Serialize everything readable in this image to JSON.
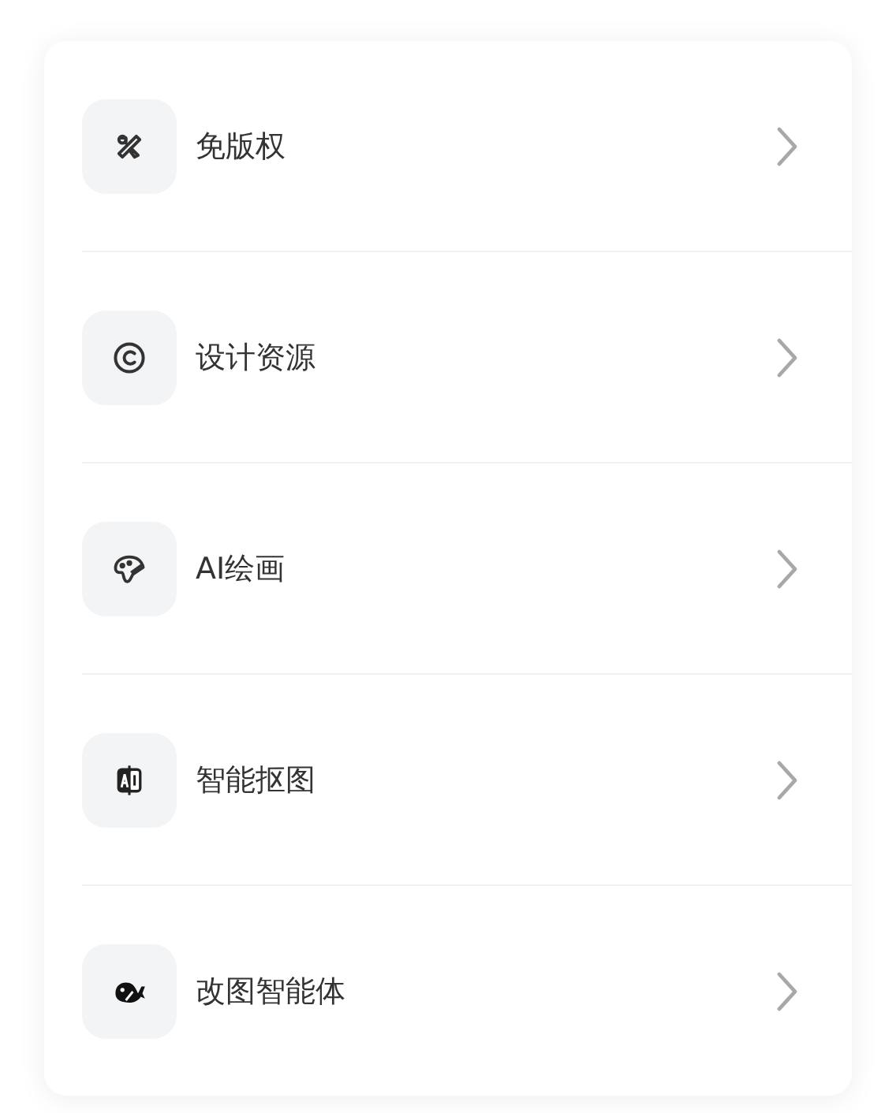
{
  "menu": {
    "items": [
      {
        "label": "免版权"
      },
      {
        "label": "设计资源"
      },
      {
        "label": "AI绘画"
      },
      {
        "label": "智能抠图"
      },
      {
        "label": "改图智能体"
      }
    ]
  }
}
